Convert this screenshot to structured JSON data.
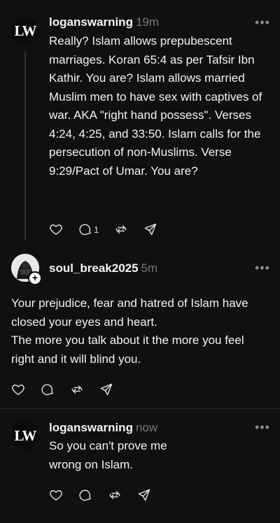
{
  "posts": [
    {
      "avatar_text": "LW",
      "username": "loganswarning",
      "time": "19m",
      "more": "•••",
      "body": "Really? Islam allows prepubescent marriages. Koran 65:4 as per Tafsir Ibn Kathir. You are? Islam allows married Muslim men to have sex with captives of war. AKA \"right hand possess\". Verses 4:24, 4:25, and 33:50. Islam calls for the persecution of non-Muslims. Verse 9:29/Pact of Umar. You are?",
      "reply_count": "1"
    },
    {
      "avatar_badge": "+",
      "username": "soul_break2025",
      "time": "5m",
      "more": "•••",
      "body_lines": [
        "Your prejudice, fear and hatred of Islam have closed your eyes and heart.",
        "The more you talk about it the more you feel right and it will blind you."
      ]
    },
    {
      "avatar_text": "LW",
      "username": "loganswarning",
      "time": "now",
      "more": "•••",
      "body": "So you can't prove me wrong on Islam."
    }
  ],
  "icons": {
    "like": "heart-icon",
    "reply": "comment-icon",
    "repost": "repost-icon",
    "share": "send-icon"
  },
  "colors": {
    "background": "#101010",
    "text": "#f3f3f3",
    "muted": "#777777"
  }
}
